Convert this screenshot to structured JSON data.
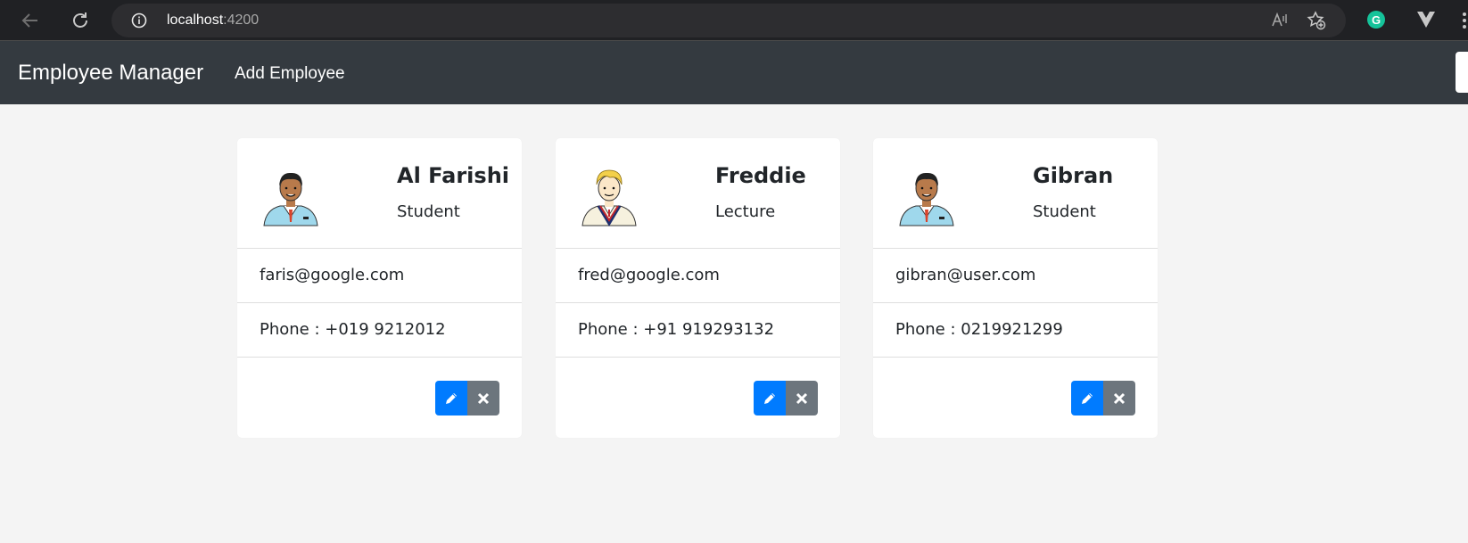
{
  "browser": {
    "url_host": "localhost",
    "url_port": ":4200",
    "read_aloud_label": "Aͅ",
    "extension_g_label": "G"
  },
  "navbar": {
    "brand": "Employee Manager",
    "add_link": "Add Employee"
  },
  "employees": [
    {
      "name": "Al Farishi",
      "role": "Student",
      "email": "faris@google.com",
      "phone": "Phone : +019 9212012",
      "avatar": "avatar-dark-hair-boy"
    },
    {
      "name": "Freddie",
      "role": "Lecture",
      "email": "fred@google.com",
      "phone": "Phone : +91 919293132",
      "avatar": "avatar-blond-boy"
    },
    {
      "name": "Gibran",
      "role": "Student",
      "email": "gibran@user.com",
      "phone": "Phone : 0219921299",
      "avatar": "avatar-dark-hair-boy"
    }
  ],
  "colors": {
    "navbar_bg": "#343a40",
    "edit_button": "#007bff",
    "delete_button": "#6c757d",
    "page_bg": "#f4f4f4"
  }
}
